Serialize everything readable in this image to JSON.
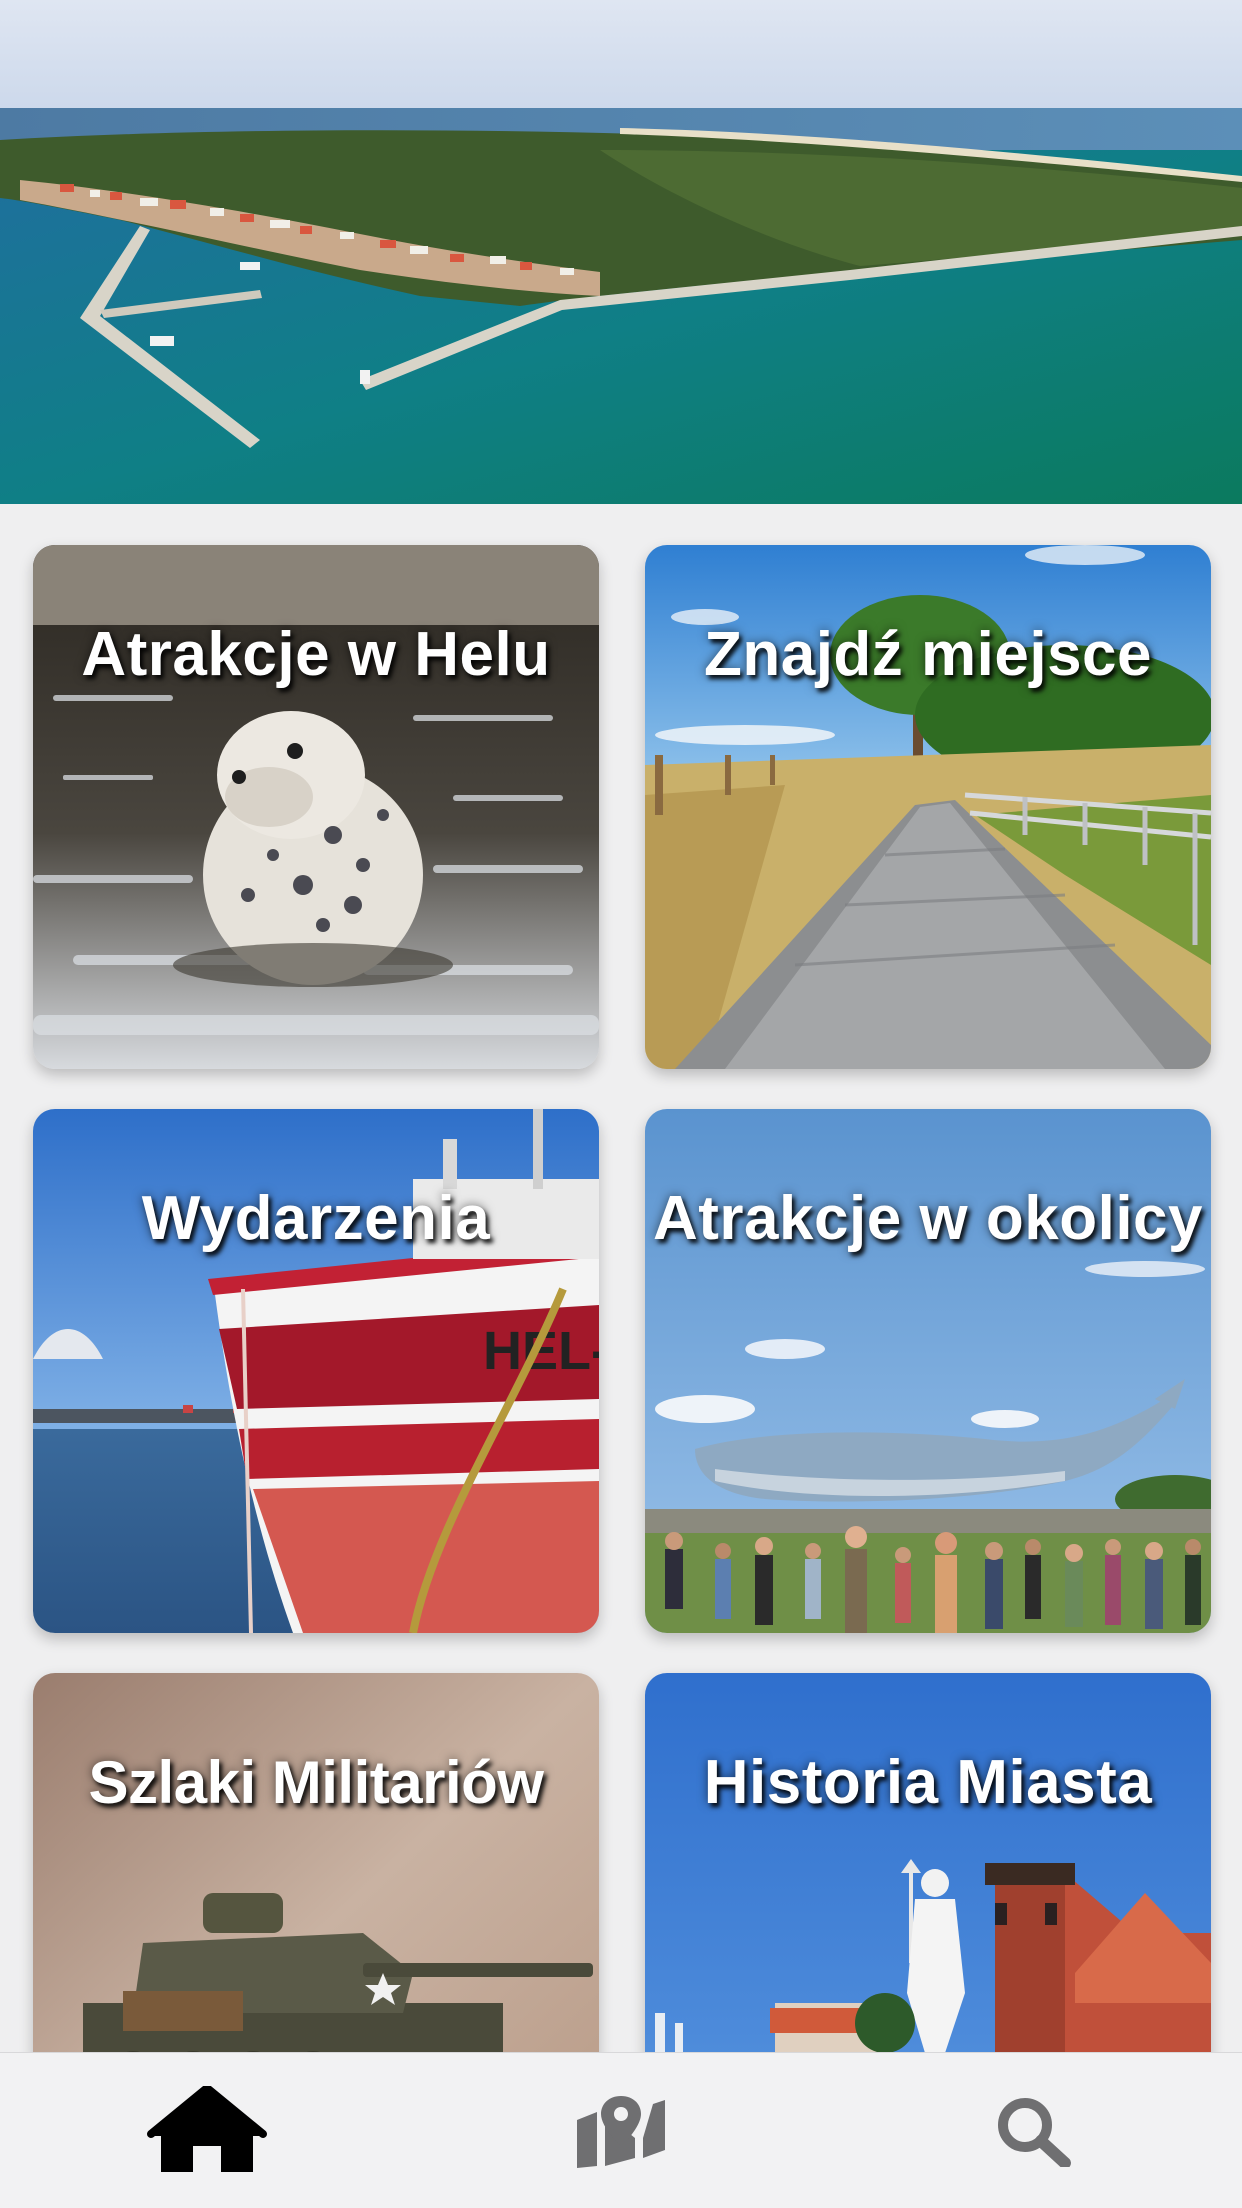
{
  "hero": {
    "image": "hel-peninsula-aerial"
  },
  "tiles": [
    {
      "label": "Atrakcje w Helu",
      "image": "seal-in-water"
    },
    {
      "label": "Znajdź miejsce",
      "image": "boardwalk-path"
    },
    {
      "label": "Wydarzenia",
      "image": "fishing-boat-hel"
    },
    {
      "label": "Atrakcje w okolicy",
      "image": "whale-sculpture-crowd"
    },
    {
      "label": "Szlaki Militariów",
      "image": "military-tank"
    },
    {
      "label": "Historia Miasta",
      "image": "neptune-statue-church"
    }
  ],
  "nav": {
    "items": [
      {
        "icon": "home-icon",
        "active": true
      },
      {
        "icon": "map-icon",
        "active": false
      },
      {
        "icon": "search-icon",
        "active": false
      }
    ],
    "active_color": "#000000",
    "inactive_color": "#6f6f71"
  }
}
